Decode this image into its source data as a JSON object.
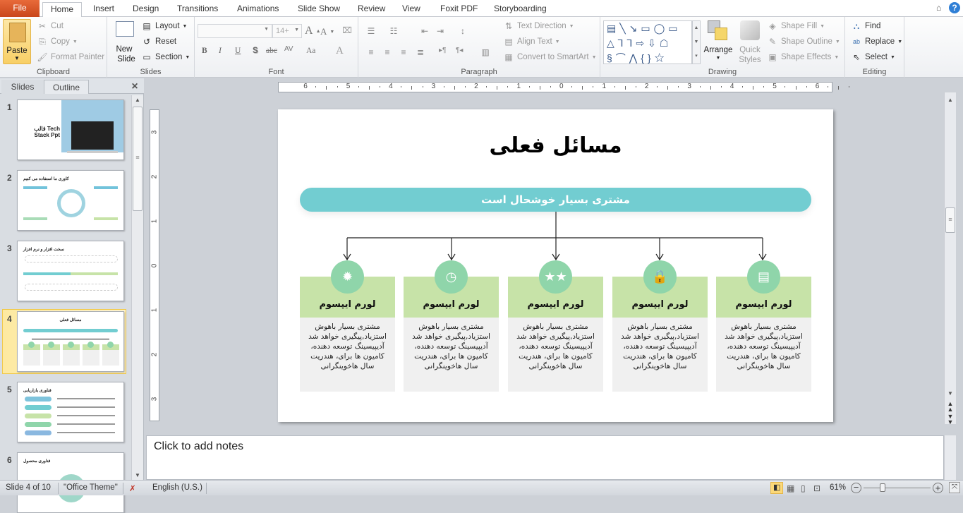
{
  "ribbon_tabs": [
    "File",
    "Home",
    "Insert",
    "Design",
    "Transitions",
    "Animations",
    "Slide Show",
    "Review",
    "View",
    "Foxit PDF",
    "Storyboarding"
  ],
  "active_tab": "Home",
  "clipboard": {
    "paste": "Paste",
    "cut": "Cut",
    "copy": "Copy",
    "format_painter": "Format Painter",
    "label": "Clipboard"
  },
  "slides_group": {
    "new_slide_1": "New",
    "new_slide_2": "Slide",
    "layout": "Layout",
    "reset": "Reset",
    "section": "Section",
    "label": "Slides"
  },
  "font": {
    "font_name": "",
    "font_size": "14+",
    "label": "Font",
    "bold": "B",
    "italic": "I",
    "underline": "U",
    "shadow": "S",
    "strike": "abc",
    "spacing": "AV",
    "case": "Aa",
    "color": "A"
  },
  "paragraph": {
    "text_direction": "Text Direction",
    "align_text": "Align Text",
    "smartart": "Convert to SmartArt",
    "label": "Paragraph"
  },
  "drawing": {
    "arrange": "Arrange",
    "quick_styles_1": "Quick",
    "quick_styles_2": "Styles",
    "shape_fill": "Shape Fill",
    "shape_outline": "Shape Outline",
    "shape_effects": "Shape Effects",
    "label": "Drawing"
  },
  "editing": {
    "find": "Find",
    "replace": "Replace",
    "select": "Select",
    "label": "Editing"
  },
  "pane": {
    "tab_slides": "Slides",
    "tab_outline": "Outline",
    "close": "×"
  },
  "thumbnails": [
    {
      "num": "1",
      "title": "Tech قالب Stack Ppt"
    },
    {
      "num": "2",
      "title": "کاوری ما استفاده می کنیم"
    },
    {
      "num": "3",
      "title": "سخت افزار و نرم افزار"
    },
    {
      "num": "4",
      "title": "مسائل فعلی"
    },
    {
      "num": "5",
      "title": "فناوری بازاریابی"
    },
    {
      "num": "6",
      "title": "فناوری محصول"
    }
  ],
  "hruler_labels": [
    "6",
    "5",
    "4",
    "3",
    "2",
    "1",
    "0",
    "1",
    "2",
    "3",
    "4",
    "5",
    "6"
  ],
  "vruler_labels": [
    "3",
    "2",
    "1",
    "0",
    "1",
    "2",
    "3"
  ],
  "slide": {
    "title": "مسائل فعلی",
    "banner": "مشتری بسیار خوشحال است",
    "cards": [
      {
        "icon": "document-icon",
        "glyph": "▤",
        "title": "لورم ایپسوم",
        "body": "مشتری بسیار باهوش استزیاد,پیگیری خواهد شد آدیپیسینگ توسعه دهنده، کامیون ها برای، هندریت سال هاخوینگرانی"
      },
      {
        "icon": "lock-icon",
        "glyph": "🔒",
        "title": "لورم ایپسوم",
        "body": "مشتری بسیار باهوش استزیاد,پیگیری خواهد شد آدیپیسینگ توسعه دهنده، کامیون ها برای، هندریت سال هاخوینگرانی"
      },
      {
        "icon": "stars-icon",
        "glyph": "★★",
        "title": "لورم ایپسوم",
        "body": "مشتری بسیار باهوش استزیاد,پیگیری خواهد شد آدیپیسینگ توسعه دهنده، کامیون ها برای، هندریت سال هاخوینگرانی"
      },
      {
        "icon": "clock-icon",
        "glyph": "◷",
        "title": "لورم ایپسوم",
        "body": "مشتری بسیار باهوش استزیاد,پیگیری خواهد شد آدیپیسینگ توسعه دهنده، کامیون ها برای، هندریت سال هاخوینگرانی"
      },
      {
        "icon": "gear-icon",
        "glyph": "✹",
        "title": "لورم ایپسوم",
        "body": "مشتری بسیار باهوش استزیاد,پیگیری خواهد شد آدیپیسینگ توسعه دهنده، کامیون ها برای، هندریت سال هاخوینگرانی"
      }
    ]
  },
  "notes_placeholder": "Click to add notes",
  "status": {
    "slide": "Slide 4 of 10",
    "theme": "\"Office Theme\"",
    "language": "English (U.S.)",
    "zoom": "61%",
    "zoom_level_percent": 61
  },
  "colors": {
    "banner": "#72cdd1",
    "card_head": "#c7e3a8",
    "card_body": "#f0f0f0",
    "icon_circle": "#8fd5aa",
    "file_tab": "#d9522a"
  }
}
